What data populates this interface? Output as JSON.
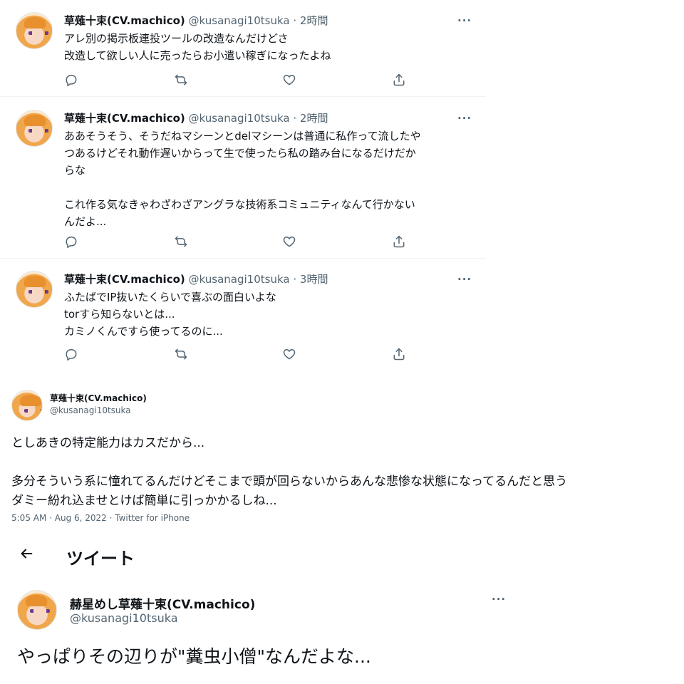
{
  "tweets": [
    {
      "name": "草薙十束(CV.machico)",
      "handle": "@kusanagi10tsuka",
      "dot": "·",
      "time": "2時間",
      "lines": [
        "アレ別の掲示板連投ツールの改造なんだけどさ",
        "改造して欲しい人に売ったらお小遣い稼ぎになったよね"
      ]
    },
    {
      "name": "草薙十束(CV.machico)",
      "handle": "@kusanagi10tsuka",
      "dot": "·",
      "time": "2時間",
      "lines": [
        "ああそうそう、そうだねマシーンとdelマシーンは普通に私作って流したや",
        "つあるけどそれ動作遅いからって生で使ったら私の踏み台になるだけだか",
        "らな",
        "",
        "これ作る気なきゃわざわざアングラな技術系コミュニティなんて行かない",
        "んだよ..."
      ]
    },
    {
      "name": "草薙十束(CV.machico)",
      "handle": "@kusanagi10tsuka",
      "dot": "·",
      "time": "3時間",
      "lines": [
        "ふたばでIP抜いたくらいで喜ぶの面白いよな",
        "torすら知らないとは...",
        "カミノくんですら使ってるのに..."
      ]
    }
  ],
  "icons": {
    "more": "more-icon",
    "reply": "reply-icon",
    "retweet": "retweet-icon",
    "like": "heart-icon",
    "share": "share-icon",
    "back": "back-arrow-icon"
  },
  "more_glyph": "···",
  "detail": {
    "name": "草薙十束(CV.machico)",
    "handle": "@kusanagi10tsuka",
    "lines": [
      "としあきの特定能力はカスだから...",
      "",
      "多分そういう系に憧れてるんだけどそこまで頭が回らないからあんな悲惨な状態になってるんだと思う",
      "ダミー紛れ込ませとけば簡単に引っかかるしね..."
    ],
    "meta": "5:05 AM · Aug 6, 2022 · Twitter for iPhone"
  },
  "bottom": {
    "page_title": "ツイート",
    "name": "赫星めし草薙十束(CV.machico)",
    "handle": "@kusanagi10tsuka",
    "text": "やっぱりその辺りが\"糞虫小僧\"なんだよな..."
  },
  "colors": {
    "text": "#0f1419",
    "secondary": "#536471",
    "divider": "#eff3f4"
  }
}
